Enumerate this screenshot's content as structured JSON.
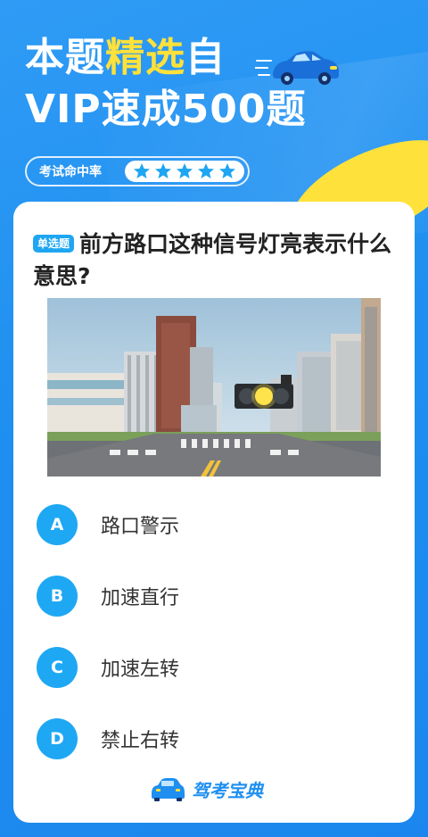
{
  "headline": {
    "line1_a": "本题",
    "line1_b": "精选",
    "line1_c": "自",
    "line2": "VIP速成500题"
  },
  "hit_rate": {
    "label": "考试命中率",
    "stars": 5
  },
  "question": {
    "badge": "单选题",
    "text": "前方路口这种信号灯亮表示什么意思?"
  },
  "options": [
    {
      "letter": "A",
      "text": "路口警示"
    },
    {
      "letter": "B",
      "text": "加速直行"
    },
    {
      "letter": "C",
      "text": "加速左转"
    },
    {
      "letter": "D",
      "text": "禁止右转"
    }
  ],
  "brand": {
    "name": "驾考宝典"
  },
  "colors": {
    "background": "#1e8ff0",
    "accent": "#ffe13b",
    "option_circle": "#1ea8f3"
  }
}
